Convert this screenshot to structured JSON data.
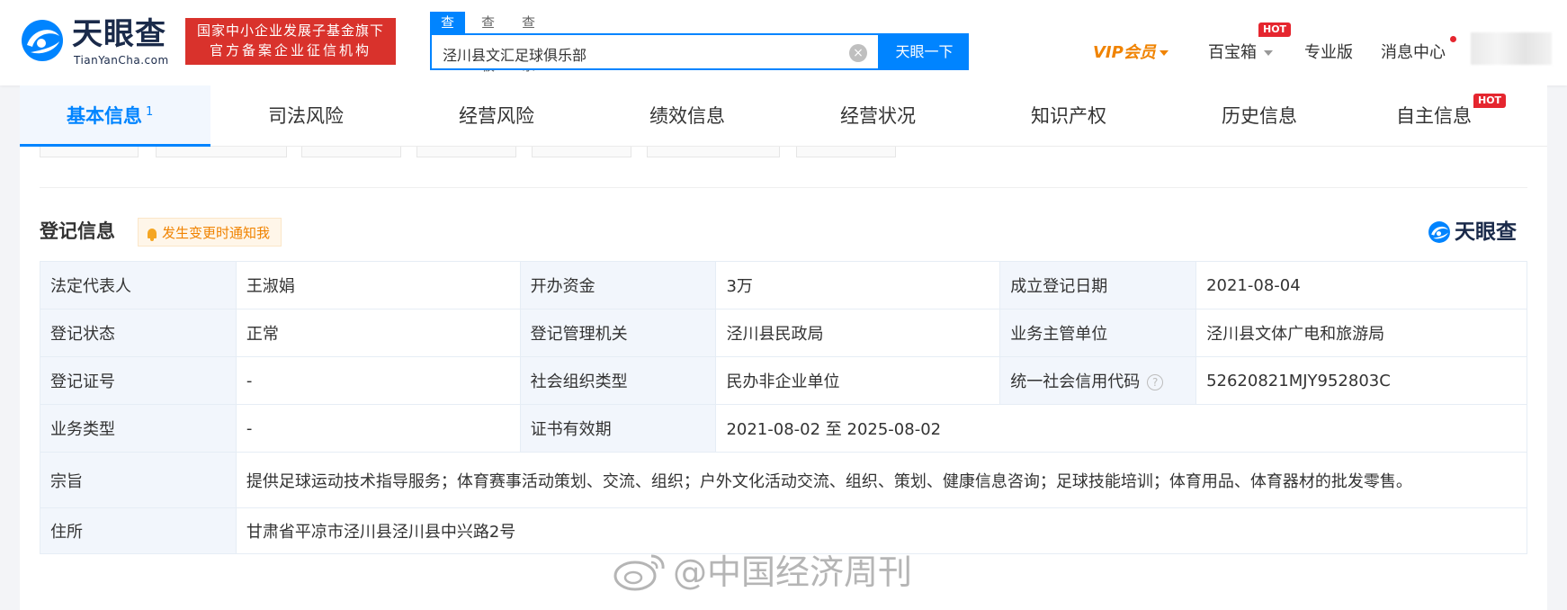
{
  "header": {
    "logo_cn": "天眼查",
    "logo_en": "TianYanCha.com",
    "badge_line1": "国家中小企业发展子基金旗下",
    "badge_line2": "官方备案企业征信机构",
    "search_tabs": [
      "查公司",
      "查老板",
      "查关系"
    ],
    "search_value": "泾川县文汇足球俱乐部",
    "search_button": "天眼一下",
    "vip_label": "VIP会员",
    "baibao_label": "百宝箱",
    "hot_badge": "HOT",
    "pro_label": "专业版",
    "message_label": "消息中心"
  },
  "tabs": [
    {
      "label": "基本信息",
      "count": "1"
    },
    {
      "label": "司法风险"
    },
    {
      "label": "经营风险"
    },
    {
      "label": "绩效信息"
    },
    {
      "label": "经营状况"
    },
    {
      "label": "知识产权"
    },
    {
      "label": "历史信息"
    },
    {
      "label": "自主信息",
      "badge": "HOT"
    }
  ],
  "section": {
    "title": "登记信息",
    "notify_label": "发生变更时通知我",
    "brand": "天眼查"
  },
  "table": {
    "rows": [
      [
        {
          "label": "法定代表人",
          "value": "王淑娟"
        },
        {
          "label": "开办资金",
          "value": "3万"
        },
        {
          "label": "成立登记日期",
          "value": "2021-08-04"
        }
      ],
      [
        {
          "label": "登记状态",
          "value": "正常"
        },
        {
          "label": "登记管理机关",
          "value": "泾川县民政局"
        },
        {
          "label": "业务主管单位",
          "value": "泾川县文体广电和旅游局"
        }
      ],
      [
        {
          "label": "登记证号",
          "value": "-"
        },
        {
          "label": "社会组织类型",
          "value": "民办非企业单位"
        },
        {
          "label": "统一社会信用代码",
          "value": "52620821MJY952803C"
        }
      ]
    ],
    "business_type": {
      "label": "业务类型",
      "value": "-"
    },
    "cert_validity": {
      "label": "证书有效期",
      "value": "2021-08-02 至 2025-08-02"
    },
    "purpose": {
      "label": "宗旨",
      "value": "提供足球运动技术指导服务；体育赛事活动策划、交流、组织；户外文化活动交流、组织、策划、健康信息咨询；足球技能培训；体育用品、体育器材的批发零售。"
    },
    "address": {
      "label": "住所",
      "value": "甘肃省平凉市泾川县泾川县中兴路2号"
    }
  },
  "watermark": "@中国经济周刊",
  "colors": {
    "accent": "#0084ff",
    "status_normal": "#29a745",
    "vip": "#f08300",
    "hot": "#e5262f",
    "badge_red": "#d9322c"
  }
}
